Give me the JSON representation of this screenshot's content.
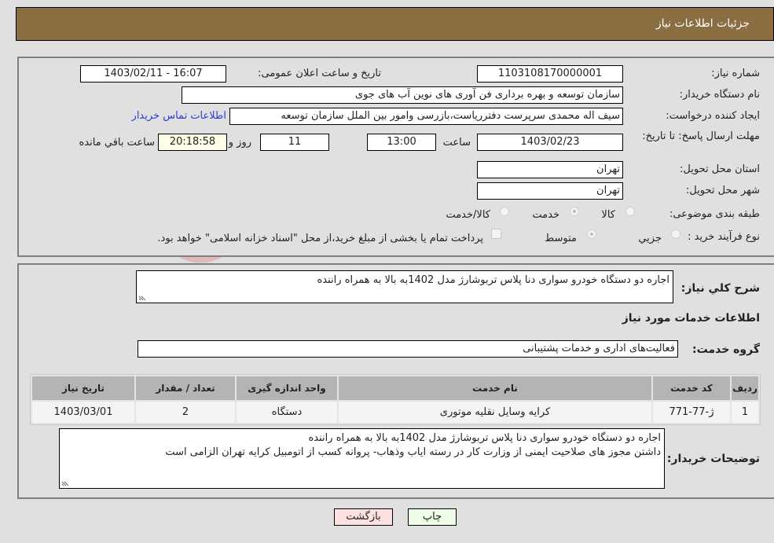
{
  "header": {
    "title": "جزئیات اطلاعات نیاز"
  },
  "details": {
    "need_number_label": "شماره نیاز:",
    "need_number": "1103108170000001",
    "announce_label": "تاریخ و ساعت اعلان عمومی:",
    "announce_value": "1403/02/11 - 16:07",
    "buyer_org_label": "نام دستگاه خریدار:",
    "buyer_org": "سازمان توسعه و بهره برداری فن آوری های نوین آب های جوی",
    "creator_label": "ایجاد کننده درخواست:",
    "creator": "سیف اله محمدی سرپرست دفترریاست،بازرسی وامور بین الملل سازمان توسعه",
    "contact_link": "اطلاعات تماس خریدار",
    "deadline_label": "مهلت ارسال پاسخ: تا تاریخ:",
    "deadline_date": "1403/02/23",
    "time_label": "ساعت",
    "deadline_time": "13:00",
    "days_value": "11",
    "days_label": "روز و",
    "remaining_value": "20:18:58",
    "remaining_label": "ساعت باقي مانده",
    "province_label": "استان محل تحویل:",
    "province": "تهران",
    "city_label": "شهر محل تحویل:",
    "city": "تهران",
    "category_label": "طبقه بندی موضوعی:",
    "category_options": [
      "کالا",
      "خدمت",
      "کالا/خدمت"
    ],
    "category_selected": "خدمت",
    "process_label": "نوع فرآیند خرید :",
    "process_options": [
      "جزيي",
      "متوسط"
    ],
    "process_selected": "متوسط",
    "treasury_note": "پرداخت تمام یا بخشی از مبلغ خرید،از محل \"اسناد خزانه اسلامی\" خواهد بود."
  },
  "summary": {
    "label": "شرح كلي نياز:",
    "text": "اجاره دو دستگاه خودرو سواری دنا پلاس تربوشارژ مدل 1402به بالا به همراه راننده"
  },
  "services": {
    "section_title": "اطلاعات خدمات مورد نياز",
    "group_label": "گروه خدمت:",
    "group_value": "فعالیت‌های اداری و خدمات پشتیبانی",
    "columns": [
      "ردیف",
      "کد خدمت",
      "نام خدمت",
      "واحد اندازه گیری",
      "تعداد / مقدار",
      "تاریخ نیاز"
    ],
    "rows": [
      [
        "1",
        "ژ-77-771",
        "کرایه وسایل نقلیه موتوری",
        "دستگاه",
        "2",
        "1403/03/01"
      ]
    ]
  },
  "buyer_notes": {
    "label": "توضیحات خریدار:",
    "line1": "اجاره دو دستگاه خودرو سواری دنا پلاس تربوشارژ مدل 1402به بالا به همراه راننده",
    "line2": "داشتن مجوز های صلاحیت ایمنی از وزارت کار در رسته ایاب وذهاب- پروانه کسب از اتومبیل کرایه تهران الزامی است"
  },
  "buttons": {
    "print": "چاپ",
    "back": "بازگشت"
  },
  "colors": {
    "header_bg": "#8b6d42",
    "print_bg": "#eefee8",
    "back_bg": "#fde0e0",
    "link": "#2a3cd8"
  }
}
